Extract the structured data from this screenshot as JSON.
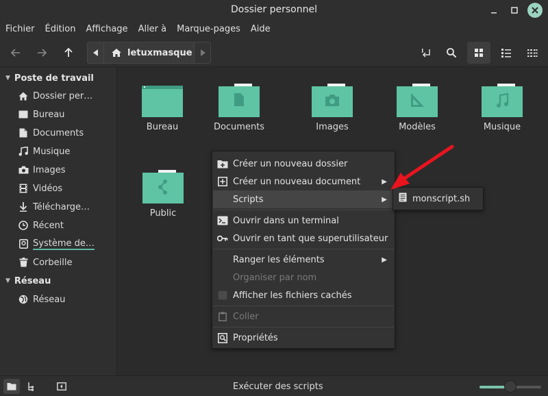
{
  "window": {
    "title": "Dossier personnel"
  },
  "menubar": {
    "items": [
      "Fichier",
      "Édition",
      "Affichage",
      "Aller à",
      "Marque-pages",
      "Aide"
    ]
  },
  "toolbar": {
    "path_crumb": "letuxmasque"
  },
  "sidebar": {
    "sections": [
      {
        "title": "Poste de travail"
      },
      {
        "title": "Réseau"
      }
    ],
    "items": [
      {
        "label": "Dossier per…",
        "icon": "home-icon"
      },
      {
        "label": "Bureau",
        "icon": "desktop-icon"
      },
      {
        "label": "Documents",
        "icon": "document-icon"
      },
      {
        "label": "Musique",
        "icon": "music-icon"
      },
      {
        "label": "Images",
        "icon": "camera-icon"
      },
      {
        "label": "Vidéos",
        "icon": "film-icon"
      },
      {
        "label": "Télécharge…",
        "icon": "download-icon"
      },
      {
        "label": "Récent",
        "icon": "clock-icon"
      },
      {
        "label": "Système de…",
        "icon": "drive-icon"
      },
      {
        "label": "Corbeille",
        "icon": "trash-icon"
      },
      {
        "label": "Réseau",
        "icon": "network-icon"
      }
    ]
  },
  "folders": [
    {
      "label": "Bureau",
      "glyph": "desktop"
    },
    {
      "label": "Documents",
      "glyph": "document"
    },
    {
      "label": "Images",
      "glyph": "camera"
    },
    {
      "label": "Modèles",
      "glyph": "template"
    },
    {
      "label": "Musique",
      "glyph": "music"
    },
    {
      "label": "Public",
      "glyph": "share"
    }
  ],
  "context_menu": {
    "items": [
      {
        "label": "Créer un nouveau dossier"
      },
      {
        "label": "Créer un nouveau document"
      },
      {
        "label": "Scripts"
      },
      {
        "label": "Ouvrir dans un terminal"
      },
      {
        "label": "Ouvrir en tant que superutilisateur"
      },
      {
        "label": "Ranger les éléments"
      },
      {
        "label": "Organiser par nom"
      },
      {
        "label": "Afficher les fichiers cachés"
      },
      {
        "label": "Coller"
      },
      {
        "label": "Propriétés"
      }
    ]
  },
  "submenu": {
    "items": [
      {
        "label": "monscript.sh"
      }
    ]
  },
  "statusbar": {
    "text": "Exécuter des scripts",
    "zoom_level": 0.5
  },
  "colors": {
    "accent": "#5fb8a0",
    "folder": "#5ec4a4",
    "arrow": "#e8141e"
  }
}
